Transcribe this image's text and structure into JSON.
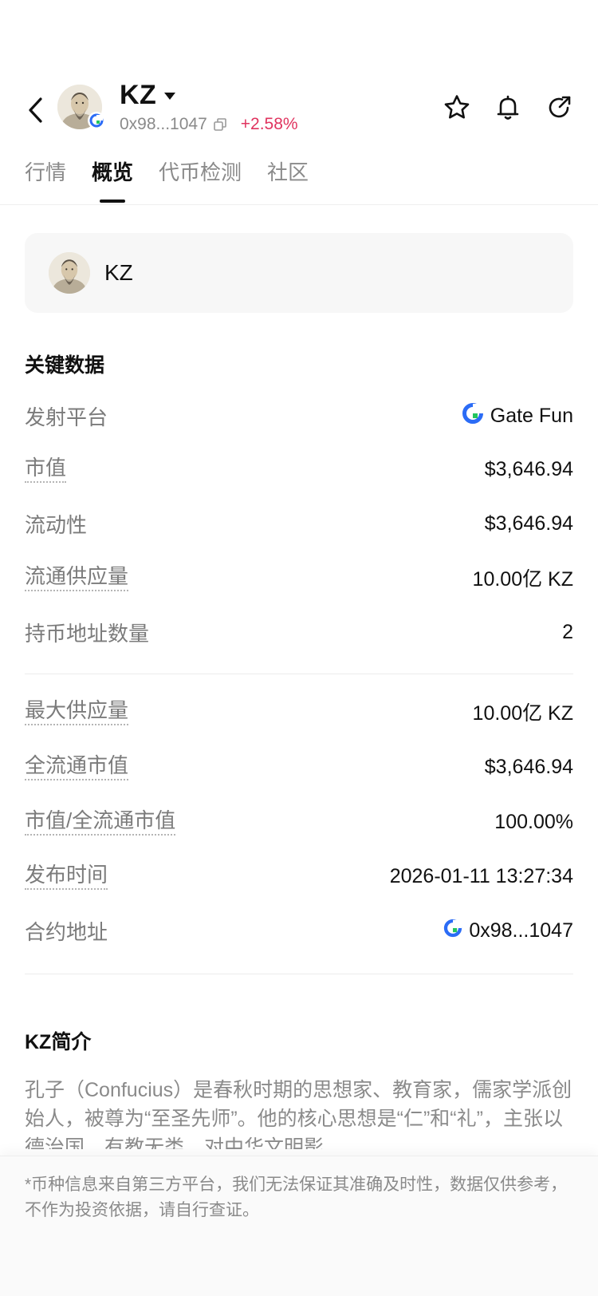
{
  "header": {
    "token_name": "KZ",
    "address_short": "0x98...1047",
    "price_change": "+2.58%",
    "icons": [
      "back-arrow-icon",
      "dropdown-caret-icon",
      "copy-icon",
      "star-icon",
      "bell-icon",
      "share-icon"
    ]
  },
  "tabs": [
    {
      "label": "行情",
      "active": false
    },
    {
      "label": "概览",
      "active": true
    },
    {
      "label": "代币检测",
      "active": false
    },
    {
      "label": "社区",
      "active": false
    }
  ],
  "token_card": {
    "name": "KZ"
  },
  "key_data": {
    "title": "关键数据",
    "launch_platform_label": "发射平台",
    "launch_platform_value": "Gate Fun",
    "market_cap_label": "市值",
    "market_cap_value": "$3,646.94",
    "liquidity_label": "流动性",
    "liquidity_value": "$3,646.94",
    "circulating_label": "流通供应量",
    "circulating_value": "10.00亿 KZ",
    "holders_label": "持币地址数量",
    "holders_value": "2",
    "max_supply_label": "最大供应量",
    "max_supply_value": "10.00亿 KZ",
    "fdv_label": "全流通市值",
    "fdv_value": "$3,646.94",
    "mcap_fdv_label": "市值/全流通市值",
    "mcap_fdv_value": "100.00%",
    "release_time_label": "发布时间",
    "release_time_value": "2026-01-11 13:27:34",
    "contract_label": "合约地址",
    "contract_value": "0x98...1047"
  },
  "intro": {
    "title": "KZ简介",
    "text": "孔子（Confucius）是春秋时期的思想家、教育家，儒家学派创始人，被尊为“至圣先师”。他的核心思想是“仁”和“礼”，主张以德治国，有教无类，对中华文明影"
  },
  "footer": {
    "disclaimer": "*币种信息来自第三方平台，我们无法保证其准确及时性，数据仅供参考，不作为投资依据，请自行查证。"
  },
  "colors": {
    "positive": "#e0345f",
    "gate_blue": "#2b6cf6",
    "gate_green": "#22c55e"
  }
}
